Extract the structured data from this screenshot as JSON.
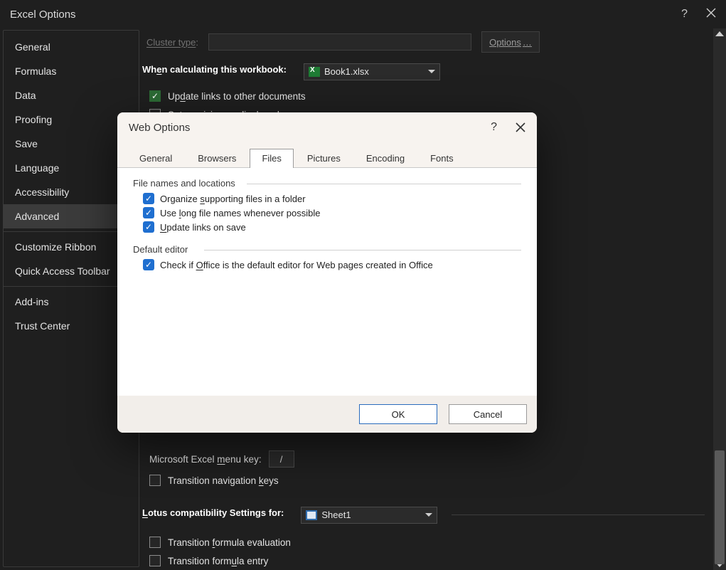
{
  "window": {
    "title": "Excel Options"
  },
  "sidebar": {
    "items": [
      {
        "label": "General"
      },
      {
        "label": "Formulas"
      },
      {
        "label": "Data"
      },
      {
        "label": "Proofing"
      },
      {
        "label": "Save"
      },
      {
        "label": "Language"
      },
      {
        "label": "Accessibility"
      },
      {
        "label": "Advanced",
        "selected": true
      },
      {
        "label": "Customize Ribbon"
      },
      {
        "label": "Quick Access Toolbar"
      },
      {
        "label": "Add-ins"
      },
      {
        "label": "Trust Center"
      }
    ]
  },
  "trunc": {
    "cluster_label_pre": "C",
    "cluster_label_mid": "luster type",
    "cluster_label_suf": ":",
    "options_label": "Options"
  },
  "calc": {
    "heading_pre": "Wh",
    "heading_u": "e",
    "heading_post": "n calculating this workbook:",
    "workbook": "Book1.xlsx",
    "update_links_pre": "Up",
    "update_links_u": "d",
    "update_links_post": "ate links to other documents",
    "precision": "Set precision as displayed"
  },
  "lotus": {
    "menu_label_pre": "Microsoft Excel ",
    "menu_label_u": "m",
    "menu_label_post": "enu key:",
    "menu_key": "/",
    "nav_keys_pre": "Transition navigation ",
    "nav_keys_u": "k",
    "nav_keys_post": "eys",
    "heading_u": "L",
    "heading_post": "otus compatibility Settings for:",
    "sheet": "Sheet1",
    "fe_pre": "Transition ",
    "fe_u": "f",
    "fe_post": "ormula evaluation",
    "fu_pre": "Transition form",
    "fu_u": "u",
    "fu_post": "la entry"
  },
  "modal": {
    "title": "Web Options",
    "tabs": [
      "General",
      "Browsers",
      "Files",
      "Pictures",
      "Encoding",
      "Fonts"
    ],
    "active_tab": "Files",
    "group1": "File names and locations",
    "opt1_pre": "Organize ",
    "opt1_u": "s",
    "opt1_post": "upporting files in a folder",
    "opt2_pre": "Use ",
    "opt2_u": "l",
    "opt2_post": "ong file names whenever possible",
    "opt3_u": "U",
    "opt3_post": "pdate links on save",
    "group2": "Default editor",
    "opt4_pre": "Check if ",
    "opt4_u": "O",
    "opt4_post": "ffice is the default editor for Web pages created in Office",
    "ok": "OK",
    "cancel": "Cancel"
  }
}
